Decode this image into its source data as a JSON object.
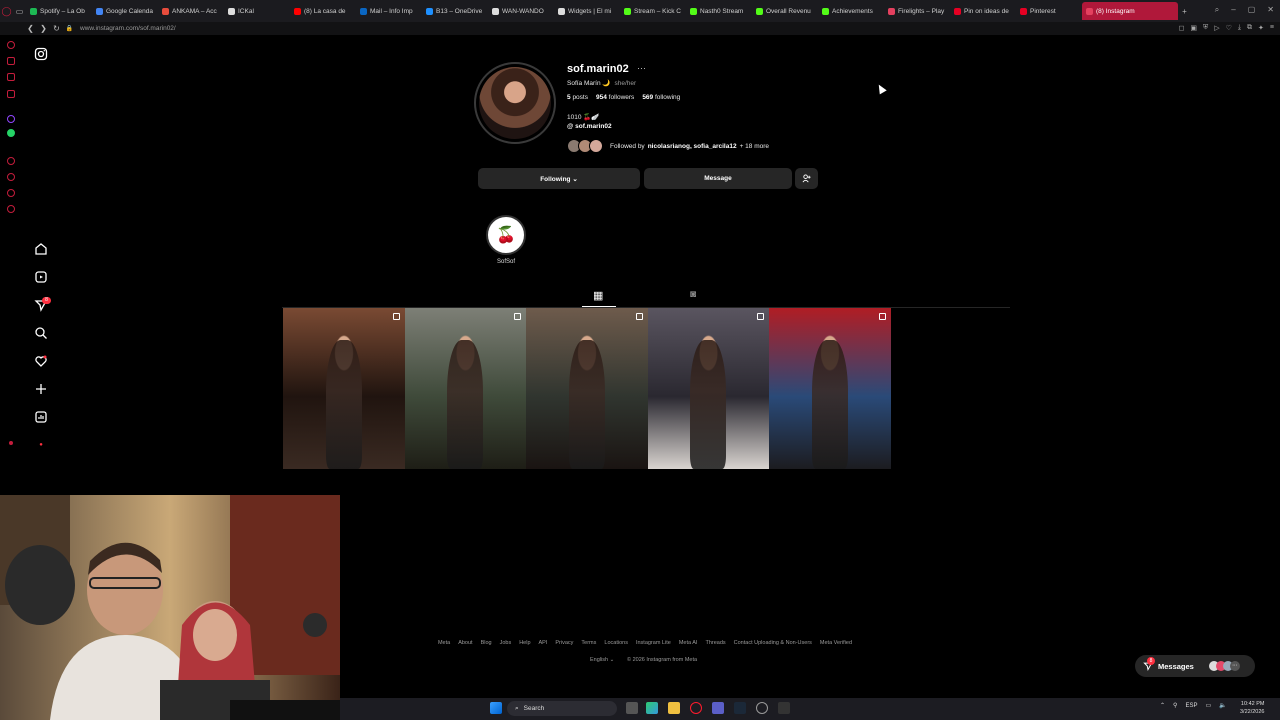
{
  "browser": {
    "tabs": [
      {
        "label": "Spotify – La Ob",
        "color": "#1db954"
      },
      {
        "label": "Google Calenda",
        "color": "#4285f4"
      },
      {
        "label": "ANKAMA – Acc",
        "color": "#e74c3c"
      },
      {
        "label": "ICKal",
        "color": "#dddddd"
      },
      {
        "label": "(8) La casa de",
        "color": "#ff0000"
      },
      {
        "label": "Mail – Info Imp",
        "color": "#0a66c2"
      },
      {
        "label": "B13 – OneDrive",
        "color": "#1e90ff"
      },
      {
        "label": "WAN-WANDO",
        "color": "#dddddd"
      },
      {
        "label": "Widgets | El mi",
        "color": "#dddddd"
      },
      {
        "label": "Stream – Kick C",
        "color": "#53fc18"
      },
      {
        "label": "Nasth0 Stream",
        "color": "#53fc18"
      },
      {
        "label": "Overall Revenu",
        "color": "#53fc18"
      },
      {
        "label": "Achievements",
        "color": "#53fc18"
      },
      {
        "label": "Firelights – Play",
        "color": "#e4405f"
      },
      {
        "label": "Pin on ideas de",
        "color": "#e60023"
      },
      {
        "label": "Pinterest",
        "color": "#e60023"
      }
    ],
    "active_tab": {
      "label": "(8) Instagram",
      "color": "#e4405f"
    },
    "new_tab": "+",
    "url": "www.instagram.com/sof.marin02/",
    "back": "❮",
    "forward": "❯",
    "reload": "↻"
  },
  "profile": {
    "username": "sof.marin02",
    "more": "···",
    "full_name": "Sofía Marín 🌙",
    "pronouns": "she/her",
    "posts_count": "5",
    "posts_label": "posts",
    "followers_count": "954",
    "followers_label": "followers",
    "following_count": "569",
    "following_label": "following",
    "bio": "1010 🍒🪽",
    "threads_handle": "@ sof.marin02",
    "followed_by_prefix": "Followed by",
    "followed_by_names": "nicolasrianog, sofia_arcila12",
    "followed_by_more": "+ 18 more"
  },
  "actions": {
    "following": "Following ⌄",
    "message": "Message",
    "add_user": "+👤"
  },
  "highlight": {
    "label": "SofSof",
    "icon": "🍒"
  },
  "tabs": {
    "grid_icon": "▦",
    "tagged_icon": "◙"
  },
  "posts": [
    {
      "colors": [
        "#7a4a33",
        "#20140f",
        "#3a2a22"
      ]
    },
    {
      "colors": [
        "#7d7f76",
        "#3f4a3a",
        "#1e1e16"
      ]
    },
    {
      "colors": [
        "#6e5b4c",
        "#30352f",
        "#1a1412"
      ]
    },
    {
      "colors": [
        "#5a5560",
        "#2a2830",
        "#d9d4d0"
      ]
    },
    {
      "colors": [
        "#b01d24",
        "#2a4a78",
        "#1c1c20"
      ]
    }
  ],
  "footer": {
    "links": [
      "Meta",
      "About",
      "Blog",
      "Jobs",
      "Help",
      "API",
      "Privacy",
      "Terms",
      "Locations",
      "Instagram Lite",
      "Meta AI",
      "Threads",
      "Contact Uploading & Non-Users",
      "Meta Verified"
    ],
    "language": "English ⌄",
    "copyright": "© 2026 Instagram from Meta"
  },
  "messages": {
    "label": "Messages",
    "badge": "8"
  },
  "taskbar": {
    "search": "Search",
    "language": "ESP",
    "time": "10:42 PM",
    "date": "3/22/2026"
  }
}
